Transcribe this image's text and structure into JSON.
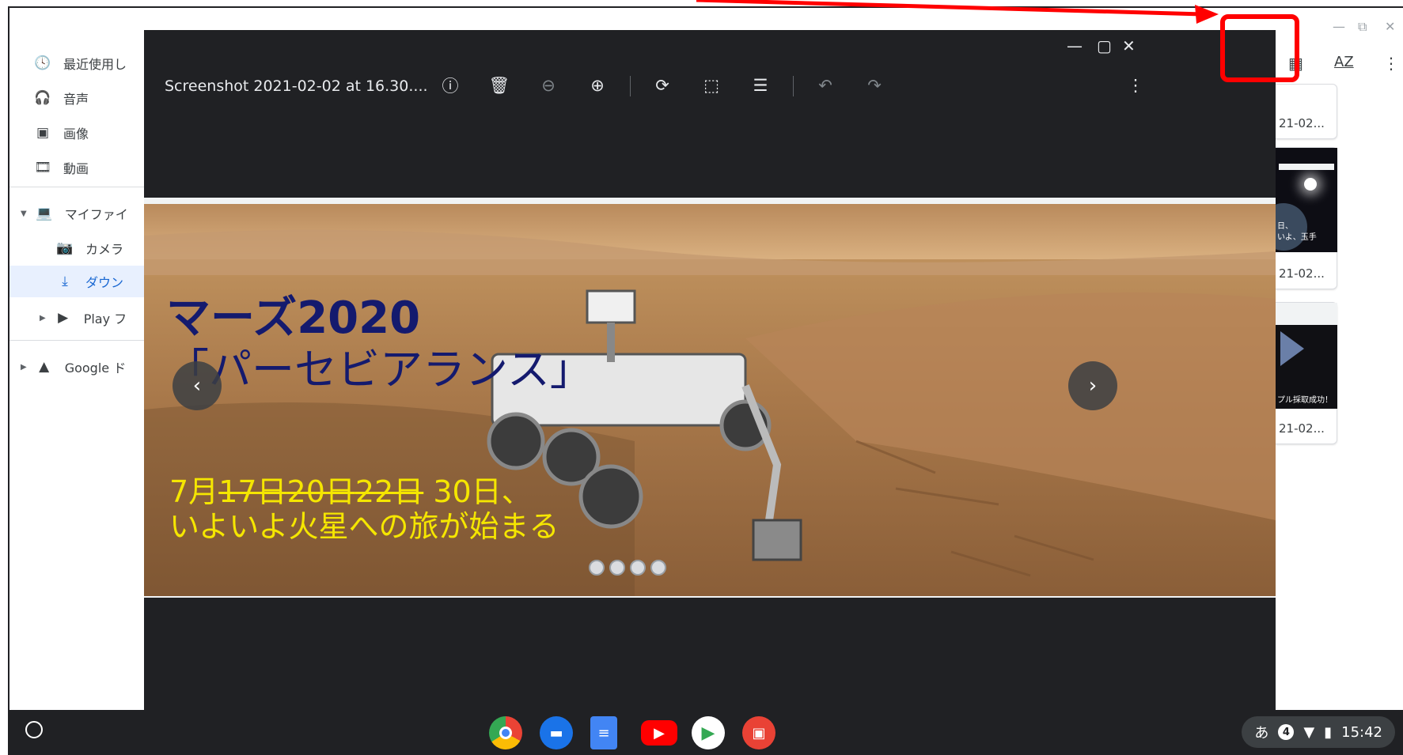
{
  "sidebar": {
    "items": [
      {
        "label": "最近使用し",
        "icon": "clock-icon"
      },
      {
        "label": "音声",
        "icon": "headphones-icon"
      },
      {
        "label": "画像",
        "icon": "image-icon"
      },
      {
        "label": "動画",
        "icon": "movie-icon"
      },
      {
        "label": "マイファイ",
        "icon": "laptop-icon"
      },
      {
        "label": "カメラ",
        "icon": "camera-icon"
      },
      {
        "label": "ダウン",
        "icon": "download-icon"
      },
      {
        "label": "Play フ",
        "icon": "play-icon"
      },
      {
        "label": "Google ド",
        "icon": "drive-icon"
      }
    ]
  },
  "files_toolbar": {
    "sort_label": "AZ"
  },
  "thumbnails": [
    {
      "date": "21-02..."
    },
    {
      "date": "21-02...",
      "caption_1": "日、",
      "caption_2": "いよ、玉手"
    },
    {
      "date": "21-02...",
      "caption": "プル採取成功！"
    }
  ],
  "viewer": {
    "title": "Screenshot 2021-02-02 at 16.30....",
    "photo": {
      "title_line1": "マーズ2020",
      "title_line2": "「パーセビアランス」",
      "date_prefix": "7月",
      "date_struck_1": "17日",
      "date_struck_2": "20日",
      "date_struck_3": "22日",
      "date_current": " 30日、",
      "date_line2": "いよいよ火星への旅が始まる"
    },
    "prev_icon": "‹",
    "next_icon": "›"
  },
  "shelf": {
    "apps": [
      "chrome",
      "files",
      "docs",
      "youtube",
      "play-store",
      "gallery"
    ],
    "tray": {
      "ime": "あ",
      "notifications": "4",
      "time": "15:42"
    }
  },
  "colors": {
    "annotation": "#ff0000",
    "viewer_bg": "#202124",
    "accent": "#1967d2"
  }
}
